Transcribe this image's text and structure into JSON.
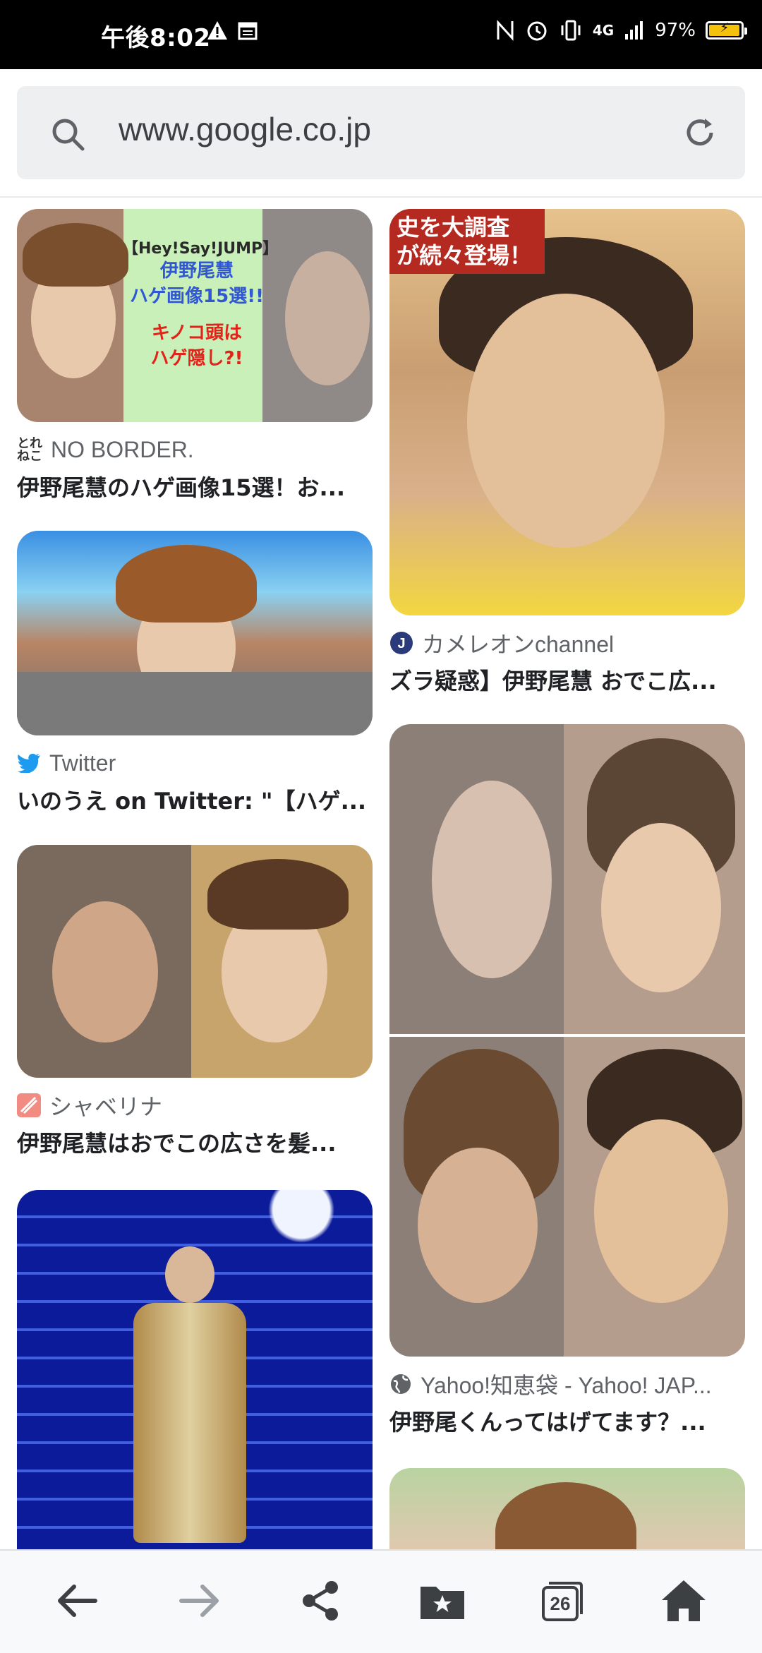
{
  "status_bar": {
    "time": "午後8:02",
    "battery_percent": "97%",
    "network": "4G",
    "battery_level": 0.97
  },
  "url_bar": {
    "url": "www.google.co.jp"
  },
  "results": [
    {
      "source": "NO BORDER.",
      "title": "伊野尾慧のハゲ画像15選！お...",
      "image_text": [
        "【Hey!Say!JUMP】",
        "伊野尾慧",
        "ハゲ画像15選!!",
        "キノコ頭は",
        "ハゲ隠し?!"
      ]
    },
    {
      "source": "Twitter",
      "title": "いのうえ on Twitter: \"【ハゲ..."
    },
    {
      "source": "シャベリナ",
      "title": "伊野尾慧はおでこの広さを髪..."
    },
    {
      "source": "カメレオンchannel",
      "title": "ズラ疑惑】伊野尾慧 おでこ広...",
      "image_text": [
        "史を大調査",
        "が続々登場！"
      ]
    },
    {
      "source": "Yahoo!知恵袋 - Yahoo! JAP...",
      "title": "伊野尾くんってはげてます？..."
    }
  ],
  "toolbar": {
    "tab_count": "26"
  },
  "colors": {
    "twitter_blue": "#1d9bf0",
    "status_bar_bg": "#000000",
    "url_bar_bg": "#eeeff0"
  }
}
